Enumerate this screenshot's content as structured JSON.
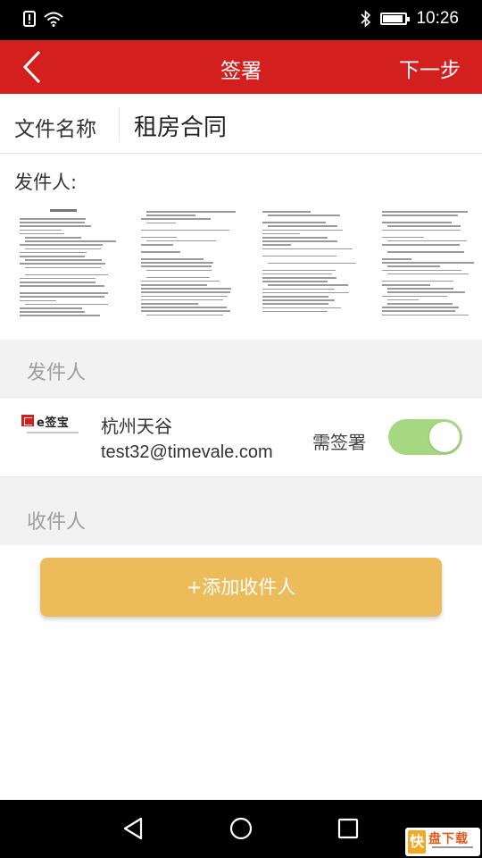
{
  "status_bar": {
    "time": "10:26",
    "battery_level": 0.9
  },
  "header": {
    "title": "签署",
    "next_label": "下一步"
  },
  "file": {
    "label": "文件名称",
    "name": "租房合同"
  },
  "sender_section": {
    "heading": "发件人:",
    "label": "发件人"
  },
  "sender": {
    "name": "杭州天谷",
    "email": "test32@timevale.com",
    "sign_label": "需签署",
    "sign_required": true
  },
  "recipient_section": {
    "label": "收件人"
  },
  "add_recipient_label": "+添加收件人",
  "document_pages": 4,
  "colors": {
    "header": "#d41f1f",
    "toggle_on": "#a6d781",
    "add_button": "#ecbc5b",
    "section_band": "#f2f2f2"
  },
  "icons": [
    "alert-icon",
    "wifi-icon",
    "bluetooth-icon",
    "battery-icon",
    "back-chevron-icon",
    "nav-back-icon",
    "nav-home-icon",
    "nav-recents-icon"
  ]
}
